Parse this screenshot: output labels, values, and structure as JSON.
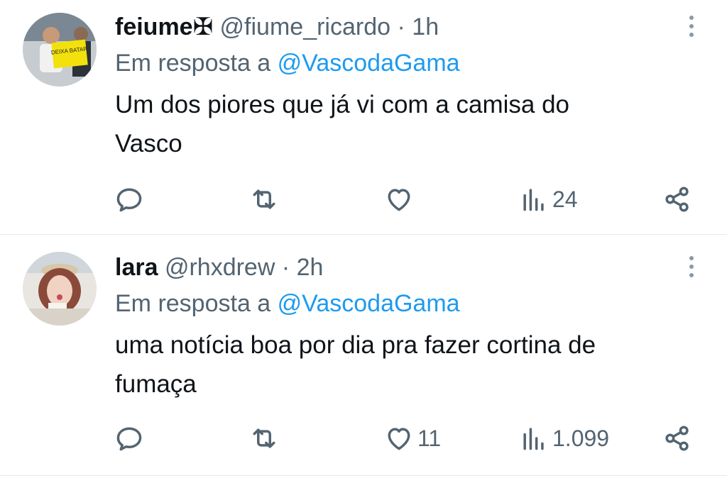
{
  "tweets": [
    {
      "display_name": "feiume",
      "name_emoji": "✠",
      "handle": "@fiume_ricardo",
      "separator": "·",
      "time": "1h",
      "reply_prefix": "Em resposta a",
      "reply_to": "@VascodaGama",
      "text_line1": "Um dos piores que já vi com a camisa do",
      "text_line2": "Vasco",
      "replies": "",
      "retweets": "",
      "likes": "",
      "views": "24",
      "avatar_sign_text": "DEIXA BATAR"
    },
    {
      "display_name": "lara",
      "name_emoji": "",
      "handle": "@rhxdrew",
      "separator": "·",
      "time": "2h",
      "reply_prefix": "Em resposta a",
      "reply_to": "@VascodaGama",
      "text_line1": "uma notícia boa por dia pra fazer cortina de",
      "text_line2": "fumaça",
      "replies": "",
      "retweets": "",
      "likes": "11",
      "views": "1.099"
    }
  ],
  "icons": {
    "reply": "reply-icon",
    "retweet": "retweet-icon",
    "like": "heart-icon",
    "views": "views-icon",
    "share": "share-icon",
    "more": "more-icon"
  },
  "colors": {
    "text": "#0f1419",
    "muted": "#536471",
    "link": "#1d9bf0",
    "divider": "#e6e9eb"
  }
}
